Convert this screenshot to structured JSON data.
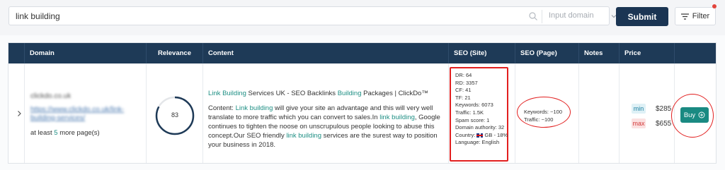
{
  "search": {
    "value": "link building",
    "domain_placeholder": "Input domain",
    "submit_label": "Submit",
    "filter_label": "Filter"
  },
  "table": {
    "headers": [
      "Domain",
      "Relevance",
      "Content",
      "SEO (Site)",
      "SEO (Page)",
      "Notes",
      "Price"
    ],
    "row": {
      "domain_line1": "clickdo.co.uk",
      "domain_line2": "https://www.clickdo.co.uk/link-",
      "domain_line3": "building-services/",
      "more_prefix": "at least ",
      "more_count": "5",
      "more_suffix": " more page(s)",
      "relevance": "83",
      "relevance_fraction": 0.83,
      "content_title": {
        "p1": "Link Building",
        "p2": " Services UK - SEO Backlinks ",
        "p3": "Building",
        "p4": " Packages | ClickDo™"
      },
      "content_body": {
        "s1": "Content: ",
        "s2": "Link building",
        "s3": " will give your site an advantage and this will very well translate to more traffic which you can convert to sales.In ",
        "s4": "link building",
        "s5": ", Google continues to tighten the noose on unscrupulous people looking to abuse this concept.Our SEO friendly ",
        "s6": "link building",
        "s7": " services are the surest way to position your business in 2018."
      },
      "seo_site": {
        "dr": "DR: 64",
        "rd": "RD: 3357",
        "cf": "CF: 41",
        "tf": "TF: 21",
        "keywords": "Keywords: 6073",
        "traffic": "Traffic: 1.5K",
        "spam": "Spam score: 1",
        "da": "Domain authority: 32",
        "country_prefix": "Country: ",
        "country_suffix": " GB - 18%",
        "language": "Language: English"
      },
      "seo_page": {
        "keywords": "Keywords: ~100",
        "traffic": "Traffic: ~100"
      },
      "price": {
        "min_label": "min",
        "min_value": "$285",
        "max_label": "max",
        "max_value": "$655"
      },
      "buy_label": "Buy"
    }
  },
  "colors": {
    "header_bg": "#1e3a57",
    "accent": "#1a8a82",
    "annotation": "#e21f1f",
    "submit_bg": "#1b3553"
  }
}
